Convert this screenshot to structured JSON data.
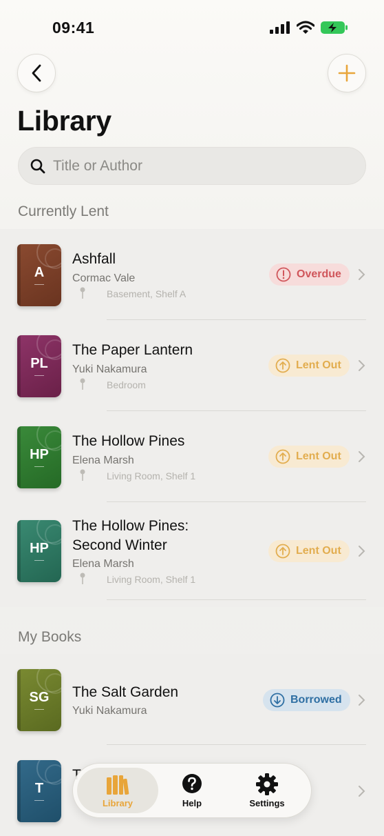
{
  "status": {
    "time": "09:41"
  },
  "colors": {
    "accent": "#e8a53a",
    "overdue": "#d0565b",
    "lent": "#e2ad4f",
    "borrowed": "#2f6fa3"
  },
  "header": {
    "title": "Library",
    "back_icon": "chevron-left-icon",
    "add_icon": "plus-icon"
  },
  "search": {
    "placeholder": "Title or Author"
  },
  "sections": {
    "lent": {
      "title": "Currently Lent",
      "items": [
        {
          "letters": "A",
          "title": "Ashfall",
          "author": "Cormac Vale",
          "location": "Basement, Shelf A",
          "status": "Overdue",
          "cover": "#7a3f2a"
        },
        {
          "letters": "PL",
          "title": "The Paper Lantern",
          "author": "Yuki Nakamura",
          "location": "Bedroom",
          "status": "Lent Out",
          "cover": "#7a2a5a"
        },
        {
          "letters": "HP",
          "title": "The Hollow Pines",
          "author": "Elena Marsh",
          "location": "Living Room, Shelf 1",
          "status": "Lent Out",
          "cover": "#2f7a32"
        },
        {
          "letters": "HP",
          "title_line1": "The Hollow Pines:",
          "title_line2": "Second Winter",
          "author": "Elena Marsh",
          "location": "Living Room, Shelf 1",
          "status": "Lent Out",
          "cover": "#2d7a62"
        }
      ]
    },
    "mine": {
      "title": "My Books",
      "items": [
        {
          "letters": "SG",
          "title": "The Salt Garden",
          "author": "Yuki Nakamura",
          "status": "Borrowed",
          "cover": "#6a7a2a"
        },
        {
          "letters": "T",
          "title": "T",
          "cover": "#2a5a78"
        }
      ]
    }
  },
  "tabs": [
    {
      "label": "Library",
      "icon": "books-icon"
    },
    {
      "label": "Help",
      "icon": "question-circle-icon"
    },
    {
      "label": "Settings",
      "icon": "gear-icon"
    }
  ]
}
